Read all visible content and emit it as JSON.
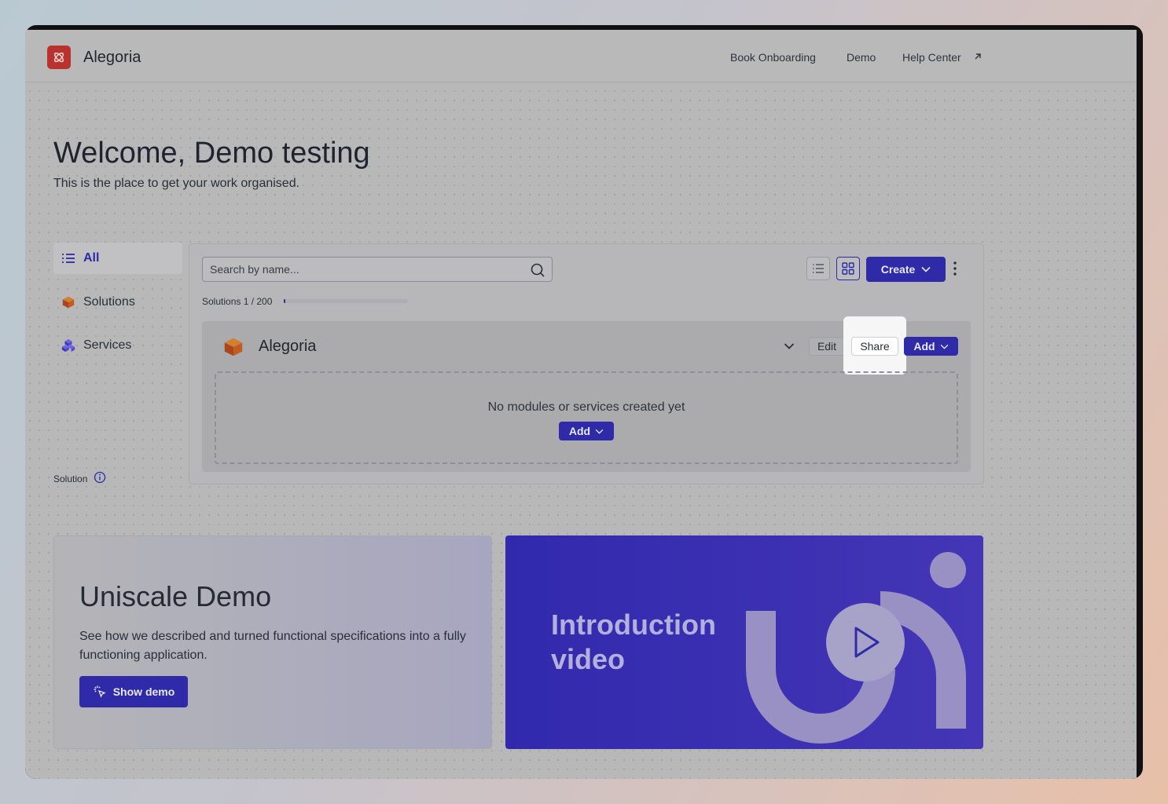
{
  "header": {
    "brand": "Alegoria",
    "nav": [
      "Book Onboarding",
      "Demo",
      "Help Center"
    ]
  },
  "welcome": {
    "title": "Welcome, Demo testing",
    "subtitle": "This is the place to get your work organised."
  },
  "sidebar": {
    "items": [
      {
        "label": "All",
        "icon": "list-icon",
        "active": true
      },
      {
        "label": "Solutions",
        "icon": "solution-cube-icon"
      },
      {
        "label": "Services",
        "icon": "service-cubes-icon"
      }
    ],
    "footer_label": "Solution"
  },
  "toolbar": {
    "search_placeholder": "Search by name...",
    "create_label": "Create",
    "count_label": "Solutions 1 / 200",
    "count_progress": 0.005
  },
  "solution_card": {
    "title": "Alegoria",
    "edit_label": "Edit",
    "share_label": "Share",
    "add_label": "Add",
    "empty_text": "No modules or services created yet",
    "empty_add_label": "Add"
  },
  "demo": {
    "title": "Uniscale Demo",
    "description": "See how we described and turned functional specifications into a fully functioning application.",
    "button_label": "Show demo"
  },
  "video": {
    "title": "Introduction video"
  },
  "colors": {
    "accent": "#2f2aa8",
    "brand_logo": "#b8322e"
  }
}
